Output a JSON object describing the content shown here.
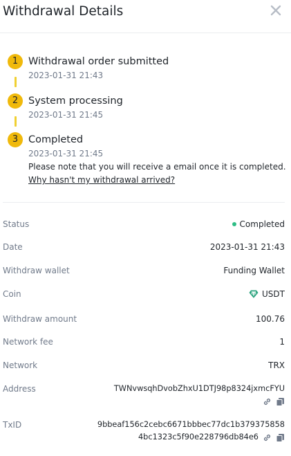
{
  "header": {
    "title": "Withdrawal Details"
  },
  "steps": [
    {
      "num": "1",
      "title": "Withdrawal order submitted",
      "time": "2023-01-31 21:43"
    },
    {
      "num": "2",
      "title": "System processing",
      "time": "2023-01-31 21:45"
    },
    {
      "num": "3",
      "title": "Completed",
      "time": "2023-01-31 21:45"
    }
  ],
  "note": {
    "text": "Please note that you will receive a email once it is completed.",
    "link": "Why hasn't my withdrawal arrived?"
  },
  "details": {
    "status": {
      "label": "Status",
      "value": "Completed"
    },
    "date": {
      "label": "Date",
      "value": "2023-01-31 21:43"
    },
    "wallet": {
      "label": "Withdraw wallet",
      "value": "Funding Wallet"
    },
    "coin": {
      "label": "Coin",
      "value": "USDT"
    },
    "amount": {
      "label": "Withdraw amount",
      "value": "100.76"
    },
    "fee": {
      "label": "Network fee",
      "value": "1"
    },
    "network": {
      "label": "Network",
      "value": "TRX"
    },
    "address": {
      "label": "Address",
      "value": "TWNvwsqhDvobZhxU1DTJ98p8324jxmcFYU"
    },
    "txid": {
      "label": "TxID",
      "line1": "9bbeaf156c2cebc6671bbbec77dc1b379375858",
      "line2": "4bc1323c5f90e228796db84e6"
    }
  },
  "colors": {
    "accent": "#f0b90b",
    "success": "#2ebd85",
    "muted": "#707a8a",
    "text": "#1e2329"
  },
  "icons": {
    "close": "close-icon",
    "coin": "tether-icon",
    "link": "link-icon",
    "copy": "copy-icon"
  }
}
